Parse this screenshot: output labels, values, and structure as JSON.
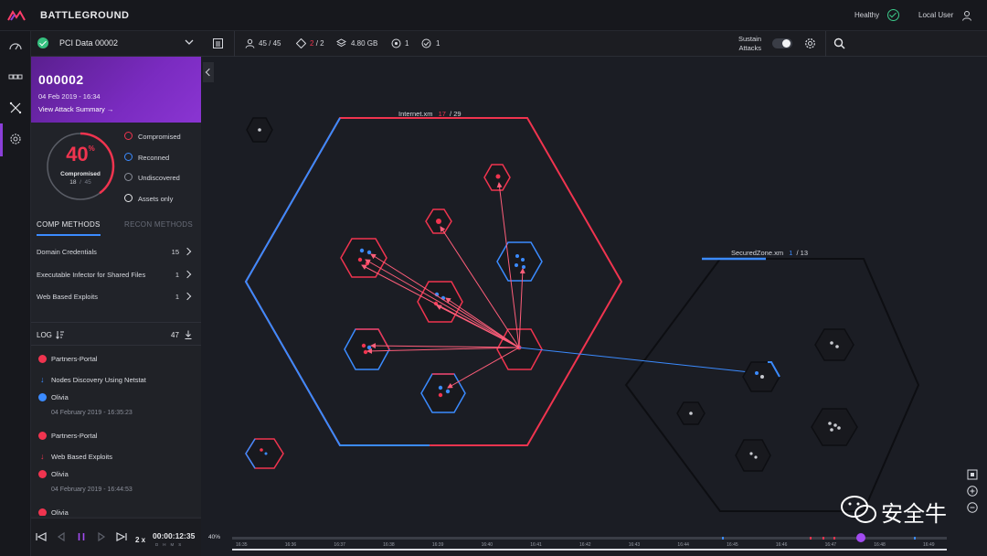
{
  "app": {
    "brand": "BATTLEGROUND",
    "health_label": "Healthy",
    "user_label": "Local User"
  },
  "dataset": {
    "name": "PCI Data",
    "id": "00002"
  },
  "attack": {
    "title": "000002",
    "date": "04 Feb 2019 - 16:34",
    "link": "View Attack Summary"
  },
  "donut": {
    "percent": "40",
    "percent_unit": "%",
    "label": "Compromised",
    "count": "18",
    "total": "45",
    "fraction": 0.4
  },
  "legend": [
    {
      "label": "Compromised",
      "color": "#f0344f"
    },
    {
      "label": "Reconned",
      "color": "#3b8bff"
    },
    {
      "label": "Undiscovered",
      "color": "#8a8e99"
    },
    {
      "label": "Assets only",
      "color": "#e6e7ea"
    }
  ],
  "tabs": {
    "comp": "COMP METHODS",
    "recon": "RECON METHODS"
  },
  "methods": [
    {
      "label": "Domain Credentials",
      "count": "15"
    },
    {
      "label": "Executable Infector for Shared Files",
      "count": "1"
    },
    {
      "label": "Web Based Exploits",
      "count": "1"
    }
  ],
  "log": {
    "title": "LOG",
    "count": "47",
    "entries": [
      {
        "kind": "node",
        "text": "Partners-Portal",
        "color": "#f0344f"
      },
      {
        "kind": "method",
        "text": "Nodes Discovery Using Netstat",
        "color": "#3b8bff"
      },
      {
        "kind": "node",
        "text": "Olivia",
        "color": "#3b8bff"
      },
      {
        "kind": "time",
        "text": "04 February 2019 - 16:35:23"
      },
      {
        "kind": "node",
        "text": "Partners-Portal",
        "color": "#f0344f"
      },
      {
        "kind": "method",
        "text": "Web Based Exploits",
        "color": "#f0344f"
      },
      {
        "kind": "node",
        "text": "Olivia",
        "color": "#f0344f"
      },
      {
        "kind": "time",
        "text": "04 February 2019 - 16:44:53"
      },
      {
        "kind": "node",
        "text": "Olivia",
        "color": "#f0344f"
      }
    ]
  },
  "player": {
    "speed": "2 x",
    "time": "00:00:12:35",
    "units": "DHMS"
  },
  "toolbar": {
    "assets": "45 / 45",
    "compromised_a": "2",
    "compromised_b": "/ 2",
    "storage": "4.80 GB",
    "stat_a": "1",
    "stat_b": "1",
    "sustain_l1": "Sustain",
    "sustain_l2": "Attacks",
    "sustain_on": false
  },
  "zones": {
    "internet": {
      "name": "Internet.xm",
      "compromised": "17",
      "total": "/ 29"
    },
    "secured": {
      "name": "SecuredZone.xm",
      "compromised": "1",
      "total": "/ 13"
    }
  },
  "timeline": {
    "percent": "40%",
    "ticks": [
      "16:35",
      "16:36",
      "16:37",
      "16:38",
      "16:39",
      "16:40",
      "16:41",
      "16:42",
      "16:43",
      "16:44",
      "16:45",
      "16:46",
      "16:47",
      "16:48",
      "16:49"
    ],
    "progress": 0.88
  },
  "watermark": {
    "text": "安全牛"
  },
  "colors": {
    "red": "#f0344f",
    "blue": "#3b8bff",
    "purple": "#8b3fd9",
    "green": "#35c07f"
  }
}
